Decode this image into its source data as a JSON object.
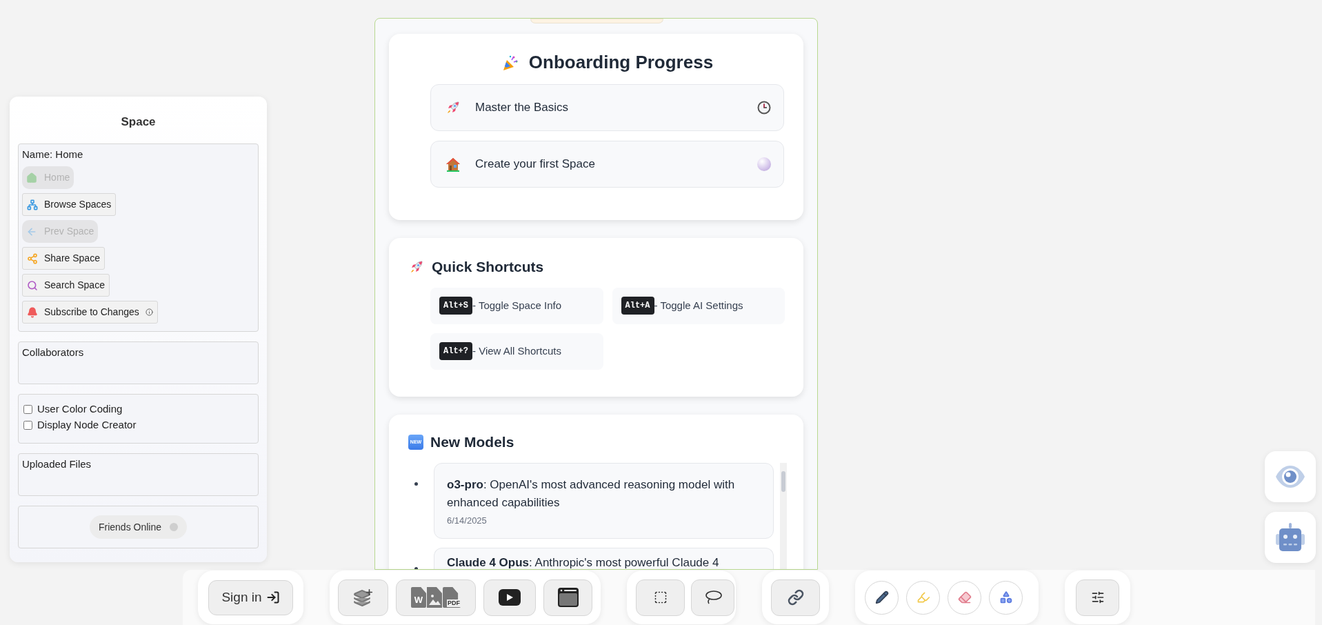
{
  "space_panel": {
    "title": "Space",
    "name_label": "Name: Home",
    "buttons": [
      {
        "kind": "home",
        "label": "Home",
        "disabled": true
      },
      {
        "kind": "browse",
        "label": "Browse Spaces",
        "disabled": false
      },
      {
        "kind": "prev",
        "label": "Prev Space",
        "disabled": true
      },
      {
        "kind": "share",
        "label": "Share Space",
        "disabled": false
      },
      {
        "kind": "search",
        "label": "Search Space",
        "disabled": false
      },
      {
        "kind": "subscribe",
        "label": "Subscribe to Changes",
        "disabled": false
      }
    ],
    "collaborators_label": "Collaborators",
    "options": [
      {
        "label": "User Color Coding",
        "checked": false
      },
      {
        "label": "Display Node Creator",
        "checked": false
      }
    ],
    "uploaded_files_label": "Uploaded Files",
    "friends_online": {
      "label": "Friends Online",
      "online": false
    }
  },
  "onboarding": {
    "title": "Onboarding Progress",
    "steps": [
      {
        "label": "Master the Basics",
        "kind": "clock"
      },
      {
        "label": "Create your first Space",
        "kind": "ball"
      }
    ]
  },
  "shortcuts": {
    "title": "Quick Shortcuts",
    "items": [
      {
        "key": "Alt+S",
        "label": "- Toggle Space Info"
      },
      {
        "key": "Alt+A",
        "label": "- Toggle AI Settings"
      },
      {
        "key": "Alt+?",
        "label": "- View All Shortcuts"
      }
    ]
  },
  "new_models": {
    "badge": "NEW",
    "title": "New Models",
    "items": [
      {
        "text": "**o3-pro**: OpenAI's most advanced reasoning model with enhanced capabilities",
        "date": "6/14/2025"
      },
      {
        "text": "**Claude 4 Opus**: Anthropic's most powerful Claude 4"
      }
    ]
  },
  "toolbar": {
    "sign_in": "Sign in",
    "file_labels": [
      "W",
      "PDF"
    ]
  }
}
